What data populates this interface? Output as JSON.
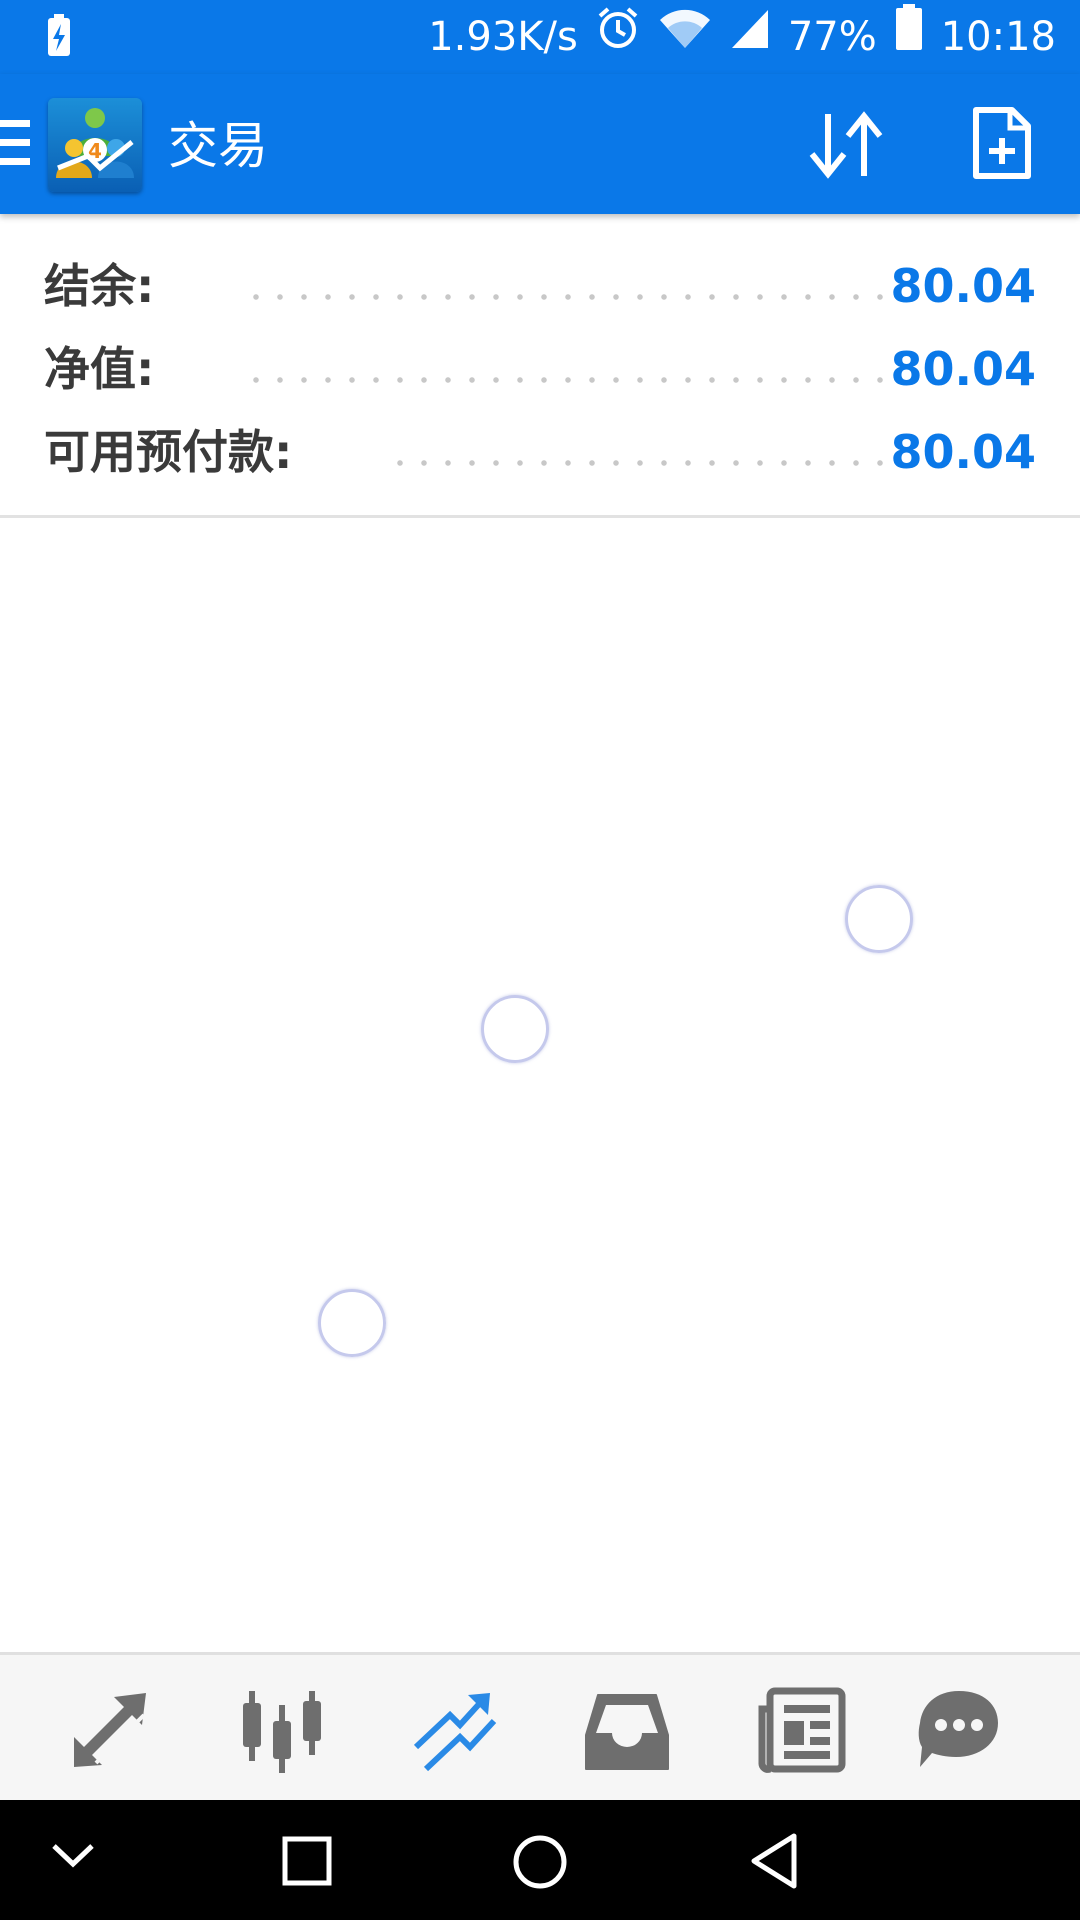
{
  "status_bar": {
    "speed": "1.93K/s",
    "network": "4G",
    "battery": "77%",
    "time": "10:18"
  },
  "app_bar": {
    "title": "交易"
  },
  "account": {
    "rows": [
      {
        "label": "结余:",
        "value": "80.04"
      },
      {
        "label": "净值:",
        "value": "80.04"
      },
      {
        "label": "可用预付款:",
        "value": "80.04"
      }
    ]
  },
  "bottom_nav": {
    "active": "trade",
    "items": [
      "quotes-icon",
      "chart-icon",
      "trade-icon",
      "history-icon",
      "news-icon",
      "chat-icon"
    ]
  },
  "colors": {
    "primary": "#0a78e8",
    "icon_inactive": "#6e6e6e",
    "active_icon": "#2a8ae6"
  }
}
